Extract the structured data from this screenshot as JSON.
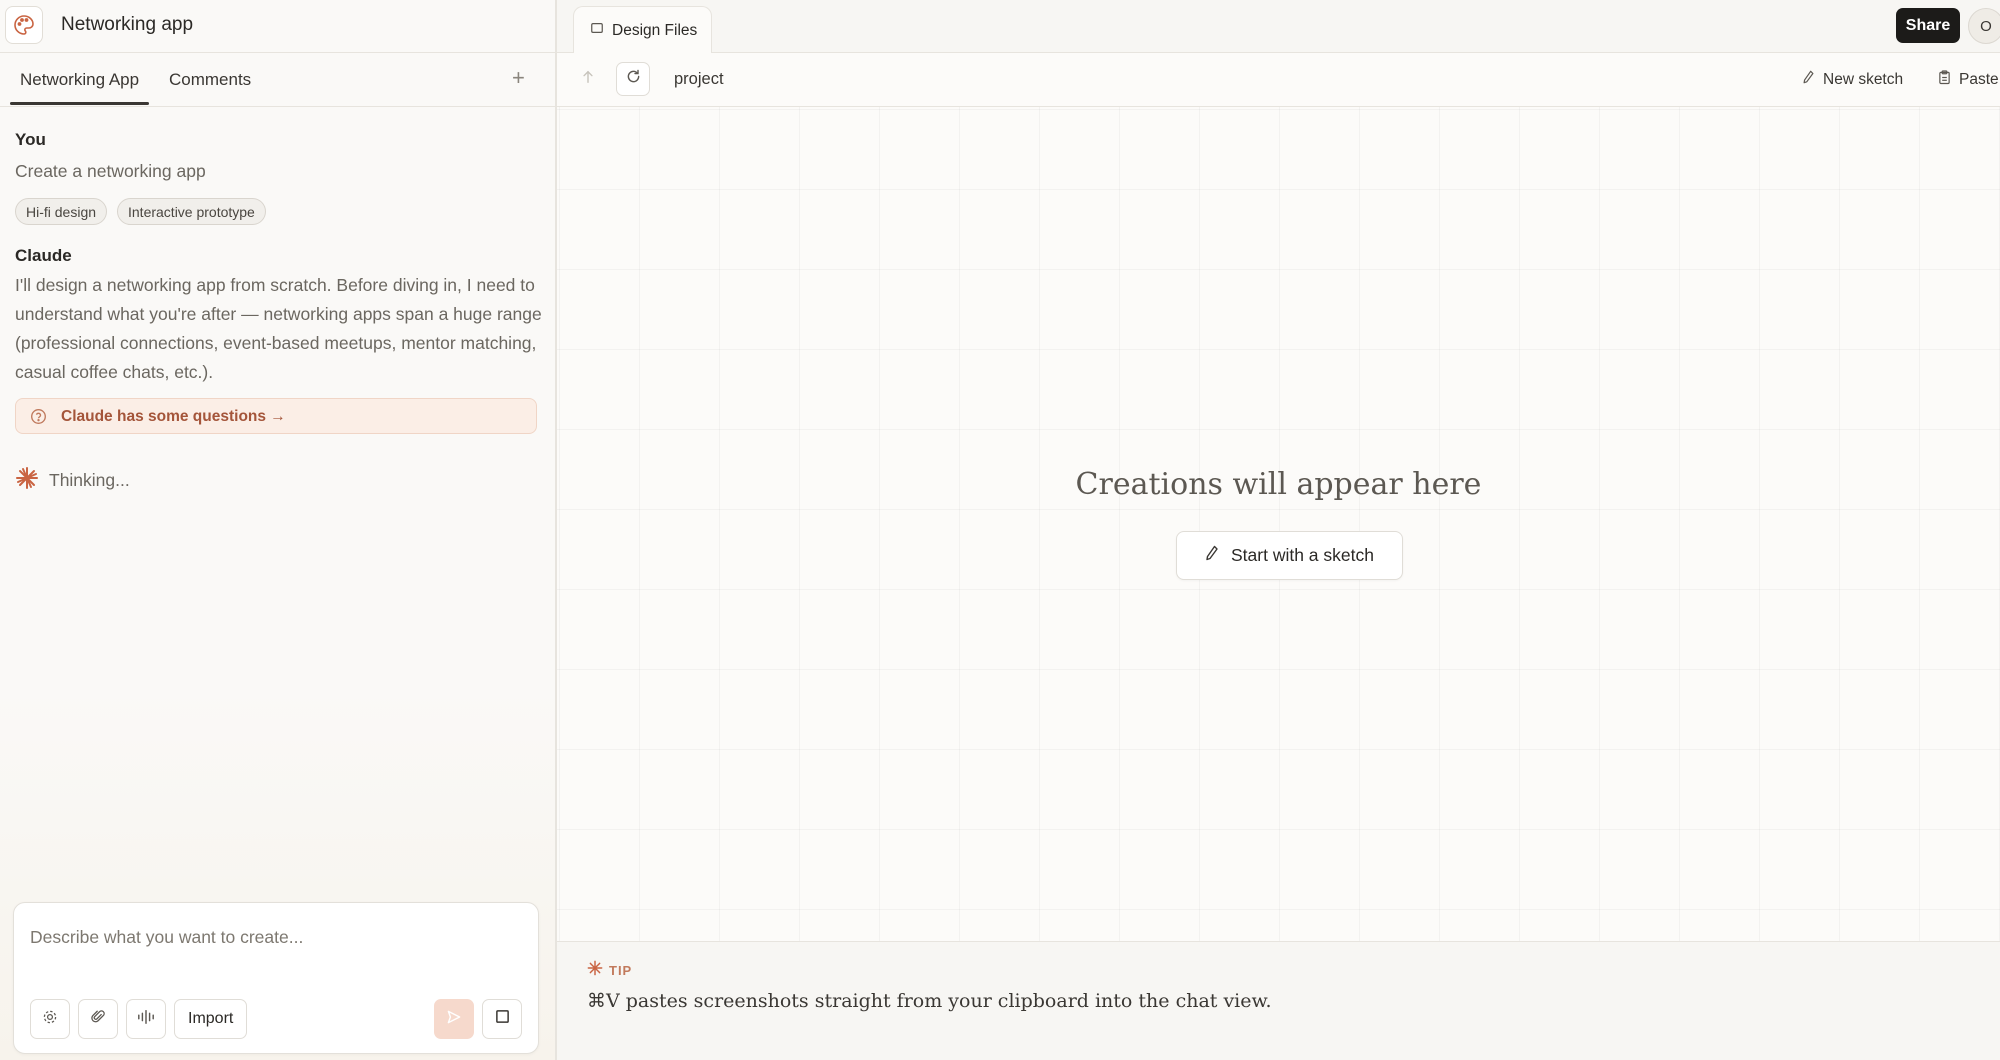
{
  "app": {
    "title": "Networking app"
  },
  "left_tabs": [
    {
      "label": "Networking App",
      "active": true
    },
    {
      "label": "Comments",
      "active": false
    }
  ],
  "add_tab_label": "+",
  "messages": {
    "user": {
      "author": "You",
      "text": "Create a networking app",
      "chips": [
        "Hi-fi design",
        "Interactive prototype"
      ]
    },
    "assistant": {
      "author": "Claude",
      "text": "I'll design a networking app from scratch. Before diving in, I need to understand what you're after — networking apps span a huge range (professional connections, event-based meetups, mentor matching, casual coffee chats, etc.).",
      "questions_label": "Claude has some questions →"
    },
    "status": "Thinking..."
  },
  "composer": {
    "placeholder": "Describe what you want to create...",
    "value": "",
    "import_label": "Import",
    "buttons": [
      "settings-icon",
      "paperclip-icon",
      "audio-icon",
      "send-icon",
      "stop-icon"
    ]
  },
  "topbar": {
    "file_tab": "Design Files",
    "share_label": "Share",
    "avatar_initial": "O"
  },
  "toolbar": {
    "breadcrumb": "project",
    "new_sketch": "New sketch",
    "paste": "Paste"
  },
  "canvas": {
    "empty_title": "Creations will appear here",
    "sketch_button": "Start with a sketch"
  },
  "tip": {
    "label": "TIP",
    "text": "⌘V pastes screenshots straight from your clipboard into the chat view."
  },
  "colors": {
    "accent": "#c96442",
    "questions_bg": "#fbeee6",
    "share_bg": "#1c1b19"
  }
}
